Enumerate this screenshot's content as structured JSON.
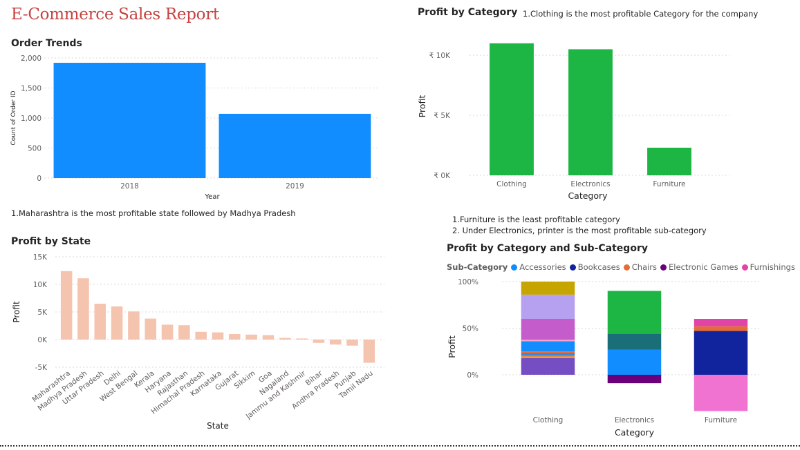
{
  "report": {
    "title": "E-Commerce Sales Report"
  },
  "order_trends": {
    "title": "Order Trends"
  },
  "state_panel": {
    "note": "1.Maharashtra is the most profitable state followed by Madhya Pradesh",
    "title": "Profit by State"
  },
  "category_panel": {
    "title": "Profit by Category",
    "note": "1.Clothing is the most profitable Category for the company"
  },
  "subcat_panel": {
    "note1": "1.Furniture is the least profitable category",
    "note2": "2. Under Electronics, printer is the most profitable sub-category",
    "title": "Profit by Category and Sub-Category"
  },
  "legend": {
    "title": "Sub-Category",
    "items": [
      {
        "label": "Accessories",
        "color": "#118dff"
      },
      {
        "label": "Bookcases",
        "color": "#12239e"
      },
      {
        "label": "Chairs",
        "color": "#e66c37"
      },
      {
        "label": "Electronic Games",
        "color": "#6b007b"
      },
      {
        "label": "Furnishings",
        "color": "#e044a7"
      }
    ],
    "more_icon": "triangle-right-icon"
  },
  "chart_data": [
    {
      "id": "order_trends",
      "type": "bar",
      "xlabel": "Year",
      "ylabel": "Count of Order ID",
      "categories": [
        "2018",
        "2019"
      ],
      "values": [
        1920,
        1070
      ],
      "ylim": [
        0,
        2000
      ],
      "yticks": [
        0,
        500,
        1000,
        1500,
        2000
      ],
      "ytick_labels": [
        "0",
        "500",
        "1,000",
        "1,500",
        "2,000"
      ],
      "color": "#118dff",
      "grid": true
    },
    {
      "id": "profit_by_state",
      "type": "bar",
      "xlabel": "State",
      "ylabel": "Profit",
      "categories": [
        "Maharashtra",
        "Madhya Pradesh",
        "Uttar Pradesh",
        "Delhi",
        "West Bengal",
        "Kerala",
        "Haryana",
        "Rajasthan",
        "Himachal Pradesh",
        "Karnataka",
        "Gujarat",
        "Sikkim",
        "Goa",
        "Nagaland",
        "Jammu and Kashmir",
        "Bihar",
        "Andhra Pradesh",
        "Punjab",
        "Tamil Nadu"
      ],
      "values": [
        12400,
        11100,
        6500,
        6000,
        5100,
        3800,
        2700,
        2600,
        1400,
        1300,
        1000,
        900,
        800,
        300,
        200,
        -600,
        -900,
        -1100,
        -4200
      ],
      "ylim": [
        -5000,
        15000
      ],
      "yticks": [
        -5000,
        0,
        5000,
        10000,
        15000
      ],
      "ytick_labels": [
        "-5K",
        "0K",
        "5K",
        "10K",
        "15K"
      ],
      "color": "#f5c4af",
      "grid": true
    },
    {
      "id": "profit_by_category",
      "type": "bar",
      "xlabel": "Category",
      "ylabel": "Profit",
      "categories": [
        "Clothing",
        "Electronics",
        "Furniture"
      ],
      "values": [
        11000,
        10500,
        2300
      ],
      "ylim": [
        0,
        11500
      ],
      "yticks": [
        0,
        5000,
        10000
      ],
      "ytick_labels": [
        "₹ 0K",
        "₹ 5K",
        "₹ 10K"
      ],
      "color": "#1db543",
      "grid": true
    },
    {
      "id": "profit_by_category_subcategory",
      "type": "bar",
      "stacked": "100%",
      "xlabel": "Category",
      "ylabel": "Profit",
      "categories": [
        "Clothing",
        "Electronics",
        "Furniture"
      ],
      "ylim": [
        -0.4,
        1.0
      ],
      "yticks": [
        0,
        0.5,
        1.0
      ],
      "ytick_labels": [
        "0%",
        "50%",
        "100%"
      ],
      "segments": [
        [
          {
            "from": 0.0,
            "to": 0.18,
            "color": "#744ec2"
          },
          {
            "from": 0.18,
            "to": 0.195,
            "color": "#d9b300"
          },
          {
            "from": 0.195,
            "to": 0.215,
            "color": "#e66c37"
          },
          {
            "from": 0.215,
            "to": 0.23,
            "color": "#118dff"
          },
          {
            "from": 0.23,
            "to": 0.25,
            "color": "#e66c37"
          },
          {
            "from": 0.25,
            "to": 0.36,
            "color": "#118dff"
          },
          {
            "from": 0.36,
            "to": 0.375,
            "color": "#f5a8c8"
          },
          {
            "from": 0.375,
            "to": 0.6,
            "color": "#c55ccb"
          },
          {
            "from": 0.6,
            "to": 0.86,
            "color": "#b6a0f0"
          },
          {
            "from": 0.86,
            "to": 1.0,
            "color": "#c7a500"
          }
        ],
        [
          {
            "from": -0.09,
            "to": 0.0,
            "color": "#6b007b"
          },
          {
            "from": 0.0,
            "to": 0.27,
            "color": "#118dff"
          },
          {
            "from": 0.27,
            "to": 0.44,
            "color": "#1a6e78"
          },
          {
            "from": 0.44,
            "to": 0.9,
            "color": "#1db543"
          }
        ],
        [
          {
            "from": -0.39,
            "to": 0.0,
            "color": "#f072d1"
          },
          {
            "from": 0.0,
            "to": 0.47,
            "color": "#12239e"
          },
          {
            "from": 0.47,
            "to": 0.52,
            "color": "#e66c37"
          },
          {
            "from": 0.52,
            "to": 0.6,
            "color": "#e044a7"
          }
        ]
      ],
      "grid": true
    }
  ]
}
